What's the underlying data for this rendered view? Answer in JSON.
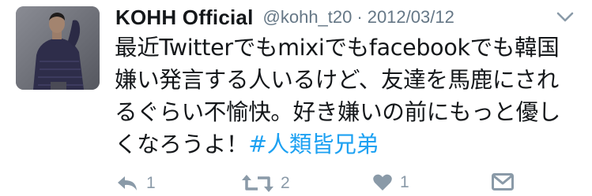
{
  "tweet": {
    "display_name": "KOHH Official",
    "handle": "@kohh_t20",
    "separator": "·",
    "date": "2012/03/12",
    "text_main": "最近Twitterでもmixiでもfacebookでも韓国嫌い発言する人いるけど、友達を馬鹿にされるぐらい不愉快。好き嫌いの前にもっと優しくなろうよ！",
    "hashtag": "#人類皆兄弟"
  },
  "actions": {
    "reply_count": "1",
    "retweet_count": "2",
    "like_count": "1"
  },
  "icons": {
    "caret": "chevron-down-icon",
    "reply": "reply-icon",
    "retweet": "retweet-icon",
    "like": "heart-icon",
    "message": "envelope-icon"
  },
  "colors": {
    "text": "#14171a",
    "secondary": "#657786",
    "action": "#8a9aa8",
    "link": "#1da1f2"
  }
}
